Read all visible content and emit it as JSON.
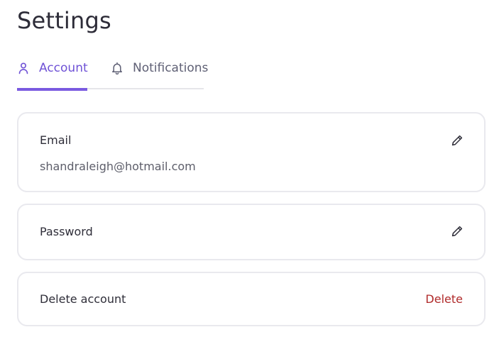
{
  "page": {
    "title": "Settings"
  },
  "tabs": [
    {
      "label": "Account",
      "icon": "user-icon",
      "active": true
    },
    {
      "label": "Notifications",
      "icon": "bell-icon",
      "active": false
    }
  ],
  "cards": {
    "email": {
      "label": "Email",
      "value": "shandraleigh@hotmail.com",
      "action_icon": "pencil-icon"
    },
    "password": {
      "label": "Password",
      "action_icon": "pencil-icon"
    },
    "delete_account": {
      "label": "Delete account",
      "action_label": "Delete"
    }
  },
  "colors": {
    "accent": "#7a5ae0",
    "danger": "#b02a2a",
    "text": "#2d2c38",
    "muted": "#5f6075"
  }
}
